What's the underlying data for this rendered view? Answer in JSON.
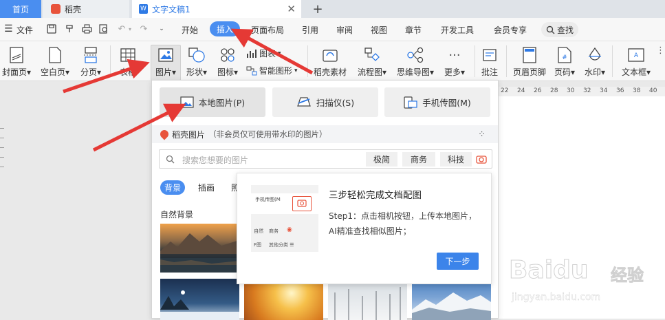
{
  "tabs": {
    "home": "首页",
    "daoke": "稻壳",
    "doc": "文字文稿1",
    "add": "+"
  },
  "menu": {
    "file": "文件",
    "items": [
      "开始",
      "插入",
      "页面布局",
      "引用",
      "审阅",
      "视图",
      "章节",
      "开发工具",
      "会员专享"
    ],
    "search": "查找"
  },
  "ribbon": {
    "cover": "封面页",
    "blank": "空白页",
    "pagebreak": "分页",
    "table": "表格",
    "picture": "图片",
    "shape": "形状",
    "icon": "图标",
    "chart": "图表",
    "smartart": "智能图形",
    "daoke_material": "稻壳素材",
    "flowchart": "流程图",
    "mindmap": "思维导图",
    "more": "更多",
    "comment": "批注",
    "header_footer": "页眉页脚",
    "page_number": "页码",
    "watermark": "水印",
    "textbox": "文本框"
  },
  "ruler": [
    "22",
    "24",
    "26",
    "28",
    "30",
    "32",
    "34",
    "36",
    "38",
    "40"
  ],
  "dropdown": {
    "local_picture": "本地图片(P)",
    "scanner": "扫描仪(S)",
    "phone": "手机传图(M)",
    "daoke_title": "稻壳图片",
    "daoke_note": "（非会员仅可使用带水印的图片）",
    "search_placeholder": "搜索您想要的图片",
    "tags": [
      "极简",
      "商务",
      "科技"
    ],
    "categories": [
      "背景",
      "插画",
      "照"
    ],
    "section": "自然背景"
  },
  "popup": {
    "title": "三步轻松完成文档配图",
    "step1": "Step1：点击相机按钮，上传本地图片，",
    "step1b": "AI精准查找相似图片；",
    "next": "下一步",
    "mini_phone": "手机传图(M",
    "mini_natural": "自然",
    "mini_business": "商务",
    "mini_f": "F图",
    "mini_other": "其他分类 ☰"
  },
  "watermark": {
    "brand": "Baidu",
    "cn": "经验",
    "url": "jingyan.baidu.com"
  },
  "colors": {
    "accent": "#4a8ef0",
    "arrow": "#e53935"
  }
}
